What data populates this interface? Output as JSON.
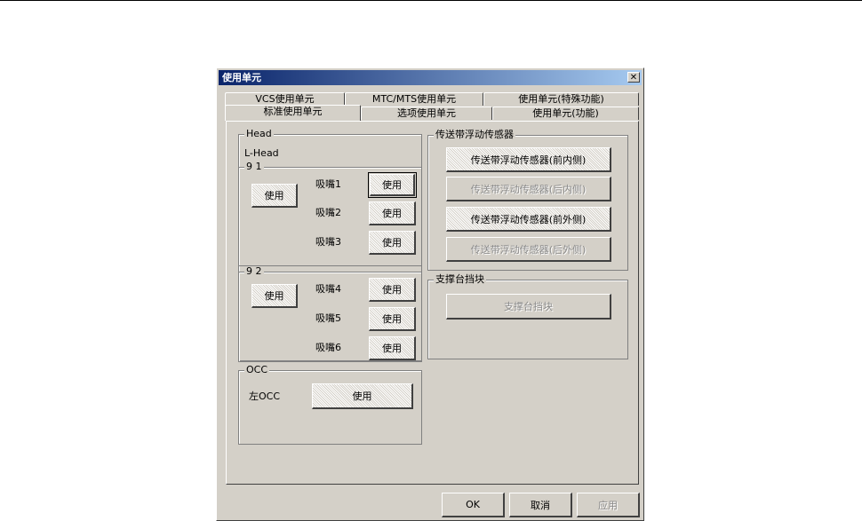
{
  "dialog": {
    "title": "使用单元",
    "close_glyph": "✕"
  },
  "tabs": {
    "row1": [
      "VCS使用单元",
      "MTC/MTS使用单元",
      "使用单元(特殊功能)"
    ],
    "row2": [
      "标准使用单元",
      "选项使用单元",
      "使用单元(功能)"
    ]
  },
  "head": {
    "legend": "Head",
    "name": "L-Head",
    "group1": {
      "legend": "9 1",
      "use_label": "使用",
      "nozzles": [
        {
          "label": "吸嘴1",
          "button": "使用"
        },
        {
          "label": "吸嘴2",
          "button": "使用"
        },
        {
          "label": "吸嘴3",
          "button": "使用"
        }
      ]
    },
    "group2": {
      "legend": "9 2",
      "use_label": "使用",
      "nozzles": [
        {
          "label": "吸嘴4",
          "button": "使用"
        },
        {
          "label": "吸嘴5",
          "button": "使用"
        },
        {
          "label": "吸嘴6",
          "button": "使用"
        }
      ]
    }
  },
  "occ": {
    "legend": "OCC",
    "left_label": "左OCC",
    "button": "使用"
  },
  "conveyor": {
    "legend": "传送带浮动传感器",
    "buttons": [
      {
        "label": "传送带浮动传感器(前内侧)",
        "enabled": true
      },
      {
        "label": "传送带浮动传感器(后内侧)",
        "enabled": false
      },
      {
        "label": "传送带浮动传感器(前外侧)",
        "enabled": true
      },
      {
        "label": "传送带浮动传感器(后外侧)",
        "enabled": false
      }
    ]
  },
  "support": {
    "legend": "支撑台挡块",
    "button": "支撑台挡块"
  },
  "footer": {
    "ok": "OK",
    "cancel": "取消",
    "apply": "应用"
  }
}
